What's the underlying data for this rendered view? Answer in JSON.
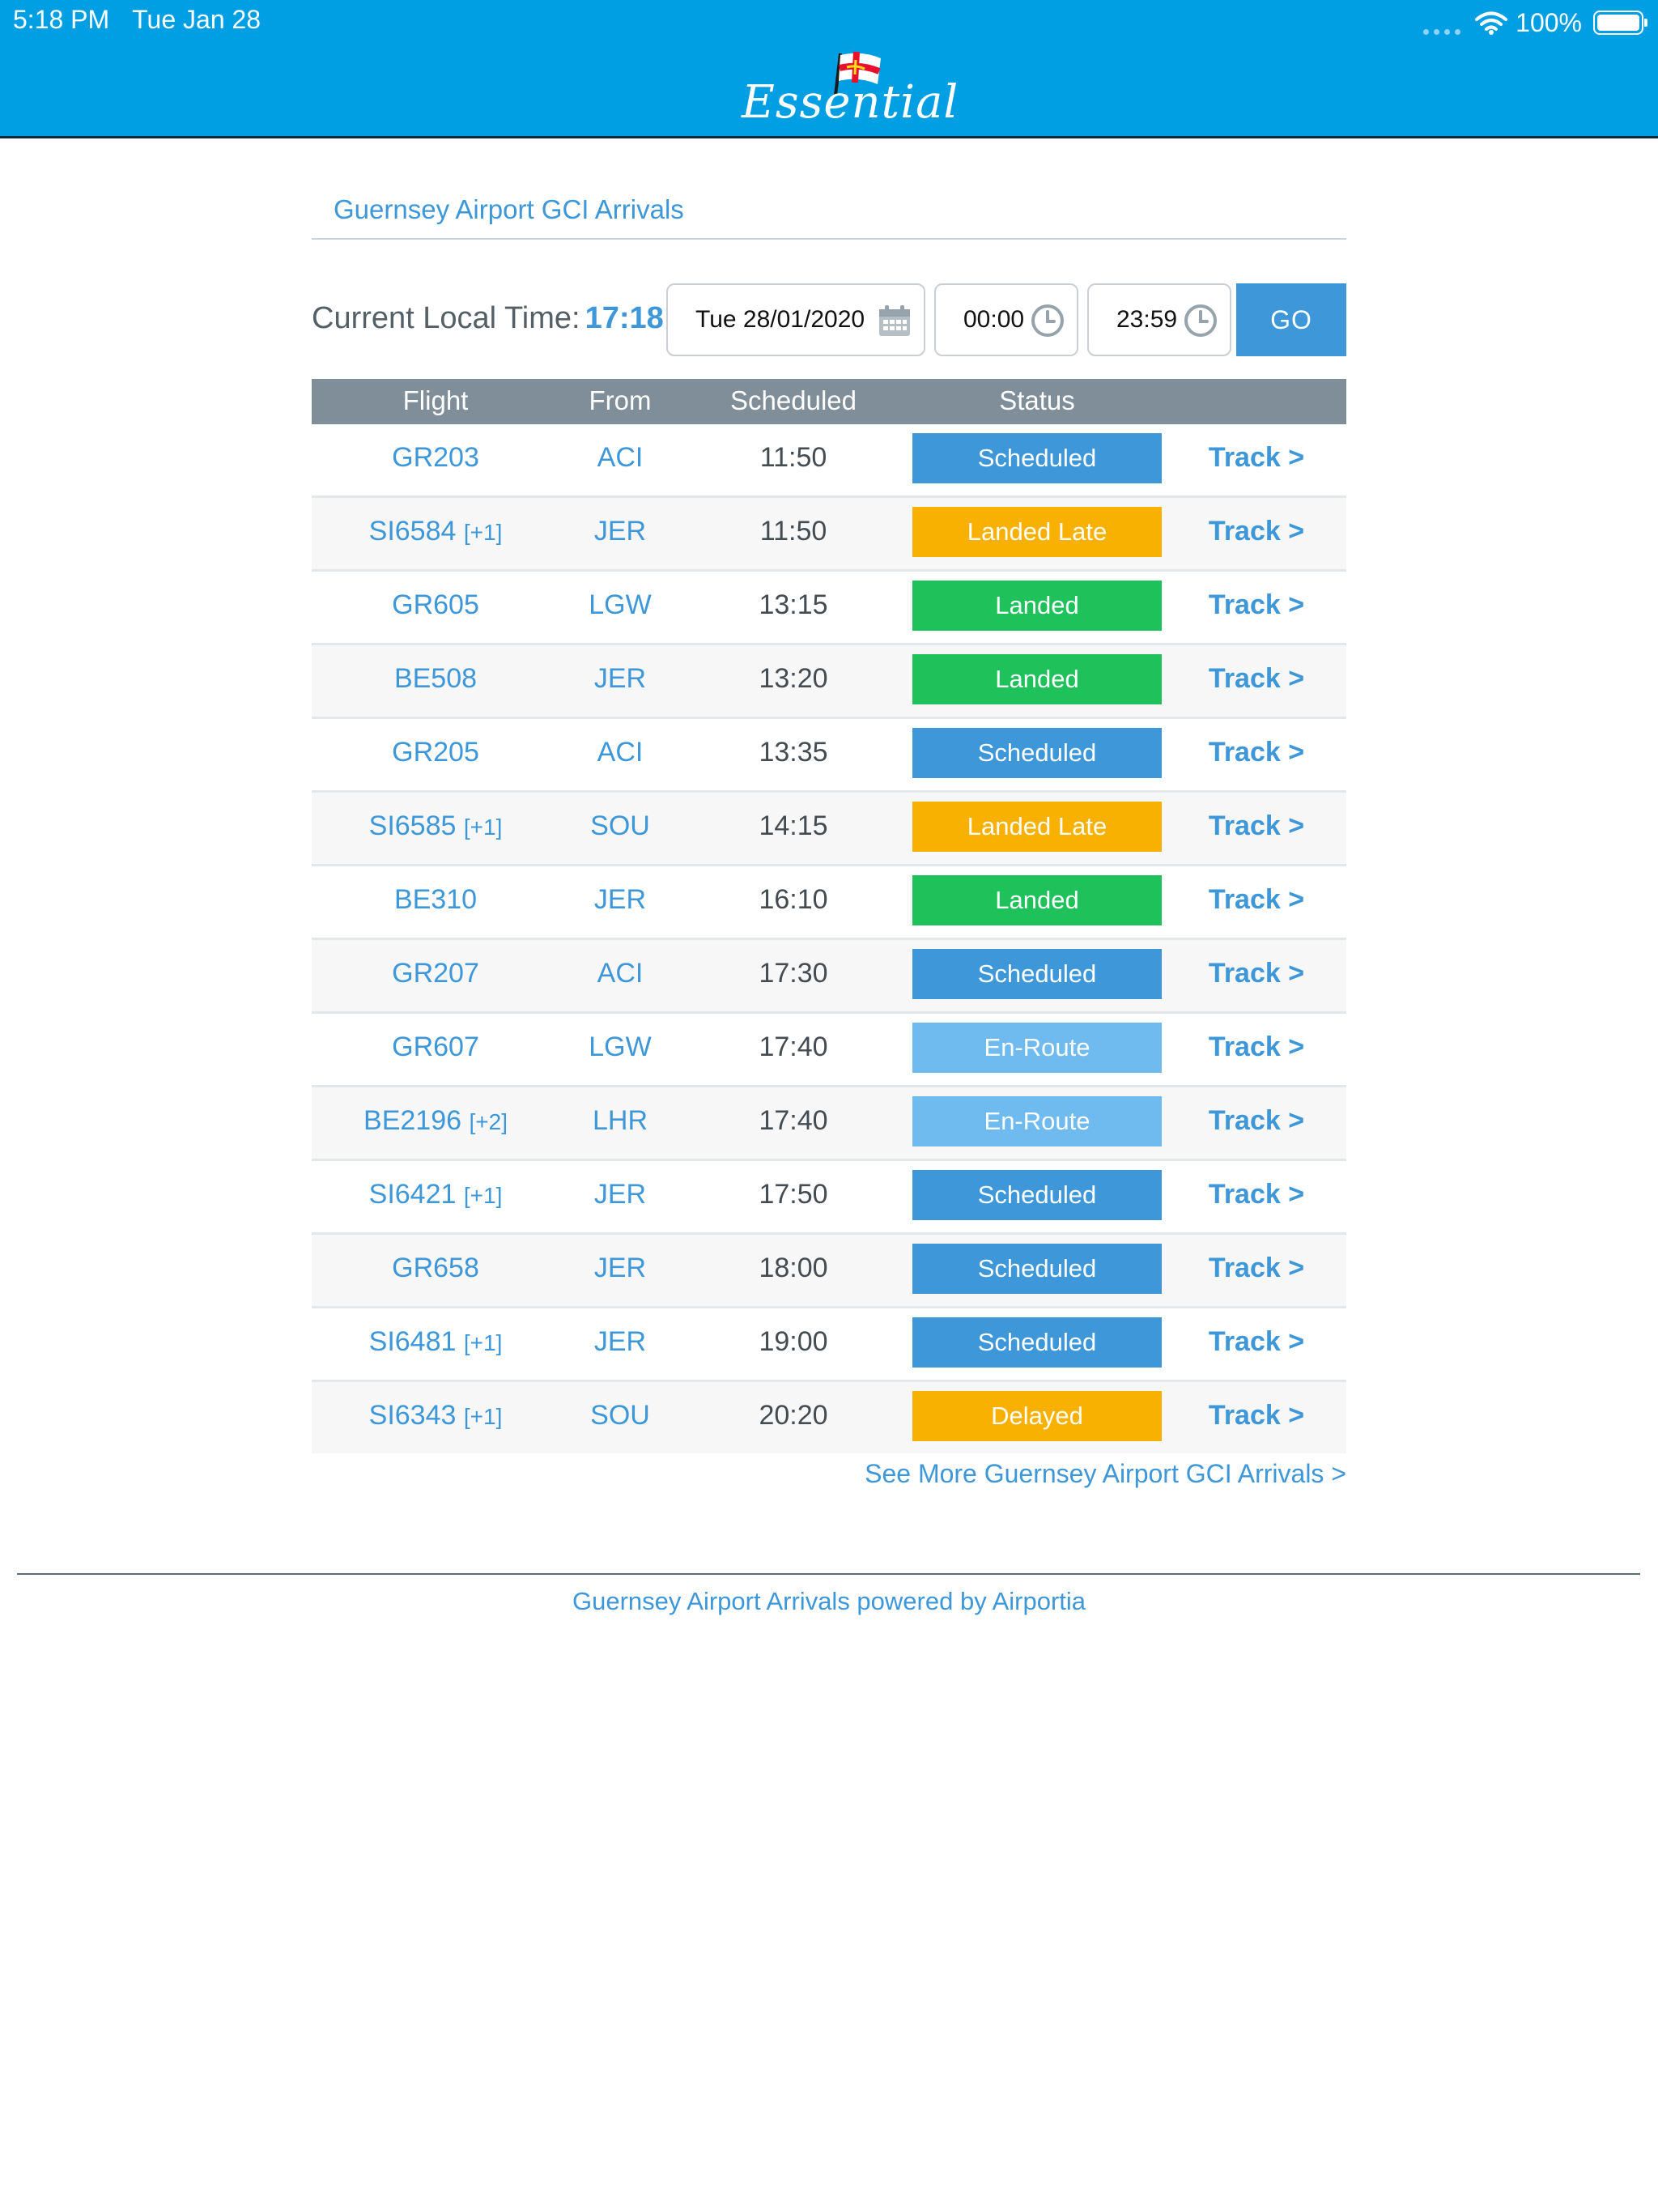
{
  "status_bar": {
    "time": "5:18 PM",
    "date": "Tue Jan 28",
    "battery": "100%",
    "wifi_icon": "wifi-icon",
    "battery_icon": "battery-icon"
  },
  "header": {
    "logo_text": "Essential",
    "flag_colors": {
      "field": "#ffffff",
      "cross": "#e8112d",
      "inner_cross": "#f9dd16"
    },
    "bar_color": "#009fe3"
  },
  "page": {
    "title": "Guernsey Airport GCI Arrivals",
    "current_time_label": "Current Local Time:",
    "current_time_value": "17:18",
    "date_value": "Tue 28/01/2020",
    "from_time": "00:00",
    "to_time": "23:59",
    "go_label": "GO"
  },
  "table": {
    "headers": {
      "flight": "Flight",
      "from": "From",
      "scheduled": "Scheduled",
      "status": "Status"
    },
    "status_colors": {
      "Scheduled": "#3d97d8",
      "Landed Late": "#f8b100",
      "Landed": "#1ec15a",
      "En-Route": "#6fbbf0",
      "Delayed": "#f8b100"
    },
    "rows": [
      {
        "flight": "GR203",
        "plus": "",
        "from": "ACI",
        "scheduled": "11:50",
        "status": "Scheduled",
        "track": "Track >"
      },
      {
        "flight": "SI6584",
        "plus": "[+1]",
        "from": "JER",
        "scheduled": "11:50",
        "status": "Landed Late",
        "track": "Track >"
      },
      {
        "flight": "GR605",
        "plus": "",
        "from": "LGW",
        "scheduled": "13:15",
        "status": "Landed",
        "track": "Track >"
      },
      {
        "flight": "BE508",
        "plus": "",
        "from": "JER",
        "scheduled": "13:20",
        "status": "Landed",
        "track": "Track >"
      },
      {
        "flight": "GR205",
        "plus": "",
        "from": "ACI",
        "scheduled": "13:35",
        "status": "Scheduled",
        "track": "Track >"
      },
      {
        "flight": "SI6585",
        "plus": "[+1]",
        "from": "SOU",
        "scheduled": "14:15",
        "status": "Landed Late",
        "track": "Track >"
      },
      {
        "flight": "BE310",
        "plus": "",
        "from": "JER",
        "scheduled": "16:10",
        "status": "Landed",
        "track": "Track >"
      },
      {
        "flight": "GR207",
        "plus": "",
        "from": "ACI",
        "scheduled": "17:30",
        "status": "Scheduled",
        "track": "Track >"
      },
      {
        "flight": "GR607",
        "plus": "",
        "from": "LGW",
        "scheduled": "17:40",
        "status": "En-Route",
        "track": "Track >"
      },
      {
        "flight": "BE2196",
        "plus": "[+2]",
        "from": "LHR",
        "scheduled": "17:40",
        "status": "En-Route",
        "track": "Track >"
      },
      {
        "flight": "SI6421",
        "plus": "[+1]",
        "from": "JER",
        "scheduled": "17:50",
        "status": "Scheduled",
        "track": "Track >"
      },
      {
        "flight": "GR658",
        "plus": "",
        "from": "JER",
        "scheduled": "18:00",
        "status": "Scheduled",
        "track": "Track >"
      },
      {
        "flight": "SI6481",
        "plus": "[+1]",
        "from": "JER",
        "scheduled": "19:00",
        "status": "Scheduled",
        "track": "Track >"
      },
      {
        "flight": "SI6343",
        "plus": "[+1]",
        "from": "SOU",
        "scheduled": "20:20",
        "status": "Delayed",
        "track": "Track >"
      }
    ]
  },
  "see_more": "See More Guernsey Airport GCI Arrivals >",
  "footer": "Guernsey Airport Arrivals powered by Airportia"
}
